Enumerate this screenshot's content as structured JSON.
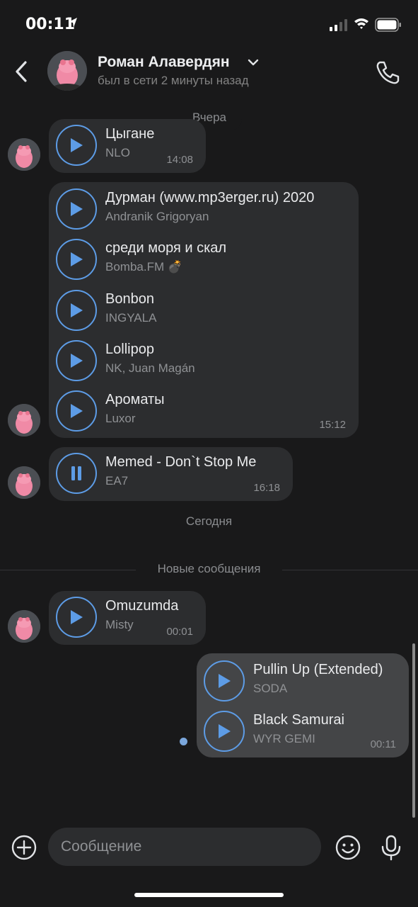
{
  "status_bar": {
    "time": "00:11"
  },
  "header": {
    "name": "Роман Алавердян",
    "status": "был в сети 2 минуты назад"
  },
  "separators": {
    "yesterday": "Вчера",
    "today": "Сегодня",
    "new_messages": "Новые сообщения"
  },
  "messages": [
    {
      "direction": "in",
      "time": "14:08",
      "tracks": [
        {
          "title": "Цыгане",
          "artist": "NLO",
          "state": "play"
        }
      ]
    },
    {
      "direction": "in",
      "time": "15:12",
      "tracks": [
        {
          "title": "Дурман (www.mp3erger.ru) 2020",
          "artist": "Andranik Grigoryan",
          "state": "play"
        },
        {
          "title": "среди моря и скал",
          "artist": "Bomba.FM 💣",
          "state": "play"
        },
        {
          "title": "Bonbon",
          "artist": "INGYALA",
          "state": "play"
        },
        {
          "title": "Lollipop",
          "artist": "NK, Juan Magán",
          "state": "play"
        },
        {
          "title": "Ароматы",
          "artist": "Luxor",
          "state": "play"
        }
      ]
    },
    {
      "direction": "in",
      "time": "16:18",
      "tracks": [
        {
          "title": "Memed  - Don`t Stop Me",
          "artist": "EA7",
          "state": "pause"
        }
      ]
    },
    {
      "direction": "in",
      "time": "00:01",
      "tracks": [
        {
          "title": "Omuzumda",
          "artist": "Misty",
          "state": "play"
        }
      ]
    },
    {
      "direction": "out",
      "time": "00:11",
      "tracks": [
        {
          "title": "Pullin Up (Extended)",
          "artist": "SODA",
          "state": "play"
        },
        {
          "title": "Black Samurai",
          "artist": "WYR GEMI",
          "state": "play"
        }
      ]
    }
  ],
  "composer": {
    "placeholder": "Сообщение"
  },
  "colors": {
    "background": "#19191a",
    "bubble_in": "#2c2d2f",
    "bubble_out": "#444547",
    "accent": "#5d9ce6"
  },
  "icons": [
    "location-arrow-icon",
    "signal-icon",
    "wifi-icon",
    "battery-icon",
    "back-icon",
    "chevron-down-icon",
    "phone-icon",
    "play-icon",
    "pause-icon",
    "plus-icon",
    "emoji-icon",
    "mic-icon"
  ]
}
